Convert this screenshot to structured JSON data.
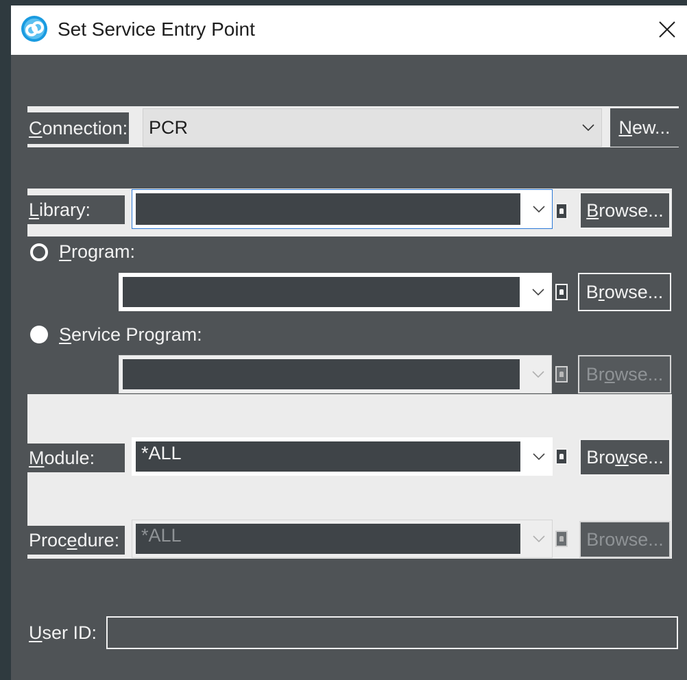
{
  "window": {
    "title": "Set Service Entry Point",
    "app_icon": "app-logo-icon",
    "close_icon": "close-icon"
  },
  "connection": {
    "label": "Connection:",
    "label_accel": "C",
    "label_rest": "onnection:",
    "value": "PCR",
    "new_button": {
      "accel": "N",
      "rest": "ew..."
    }
  },
  "library": {
    "label_accel": "L",
    "label_rest": "ibrary:",
    "value": "",
    "browse": {
      "pre": "",
      "accel": "B",
      "rest": "rowse..."
    }
  },
  "program": {
    "label_accel": "P",
    "label_rest": "rogram:",
    "selected": false,
    "value": "",
    "browse": {
      "pre": "B",
      "accel": "r",
      "rest": "owse..."
    }
  },
  "service_program": {
    "label_accel": "S",
    "label_rest": "ervice Program:",
    "selected": true,
    "value": "",
    "browse": {
      "pre": "Br",
      "accel": "o",
      "rest": "wse..."
    }
  },
  "module": {
    "label_accel": "M",
    "label_rest": "odule:",
    "value": "*ALL",
    "browse": {
      "pre": "Bro",
      "accel": "w",
      "rest": "se..."
    }
  },
  "procedure": {
    "label_pre": "Proc",
    "label_accel": "e",
    "label_rest": "dure:",
    "value": "*ALL",
    "browse": {
      "label": "Browse..."
    }
  },
  "user_id": {
    "label_accel": "U",
    "label_rest": "ser ID:",
    "value": ""
  },
  "colors": {
    "dialog_bg": "#4f5356",
    "field_bg": "#3f4448",
    "pane_bg": "#ececec",
    "focus_border": "#2b79d8",
    "app_icon_blue": "#1a9be0"
  }
}
